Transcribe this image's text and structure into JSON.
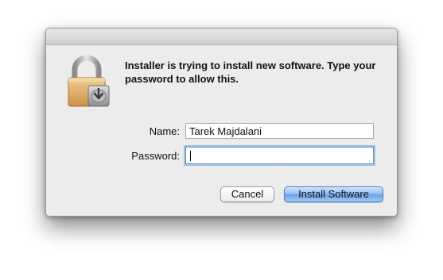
{
  "dialog": {
    "message": "Installer is trying to install new software. Type your password to allow this.",
    "icon": "lock-installer-icon"
  },
  "form": {
    "name_label": "Name:",
    "name_value": "Tarek Majdalani",
    "password_label": "Password:",
    "password_value": ""
  },
  "buttons": {
    "cancel_label": "Cancel",
    "install_label": "Install Software"
  },
  "colors": {
    "dialog_bg": "#ececec",
    "focus_ring": "#9cc1ea",
    "default_button": "#6aa2e6"
  }
}
